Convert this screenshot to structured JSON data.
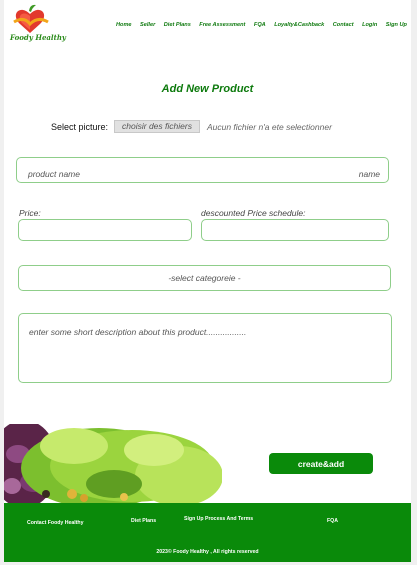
{
  "brand": {
    "name": "Foody Healthy"
  },
  "nav": {
    "items": [
      "Home",
      "Seller",
      "Diet Plans",
      "Free Assessment",
      "FQA",
      "Loyalty&Cashback",
      "Contact",
      "Login",
      "Sign Up"
    ]
  },
  "form": {
    "title": "Add New Product",
    "picture_label": "Select picture:",
    "file_button": "choisir des fichiers",
    "file_status": "Aucun fichier n'a ete selectionner",
    "product_name_placeholder": "product name",
    "product_name_suffix": "name",
    "price_label": "Price:",
    "discount_label": "descounted Price schedule:",
    "category_placeholder": "-select categoreie -",
    "description_placeholder": "enter some short description about this product.................",
    "submit_label": "create&add"
  },
  "footer": {
    "links": [
      "Contact Foody Healthy",
      "Diet Plans",
      "Sign Up Process And Terms",
      "FQA"
    ],
    "copyright": "2023© Foody Healthy , All rights reserved"
  },
  "colors": {
    "brand_green": "#0a8a0a",
    "field_border": "#8fce8a"
  }
}
